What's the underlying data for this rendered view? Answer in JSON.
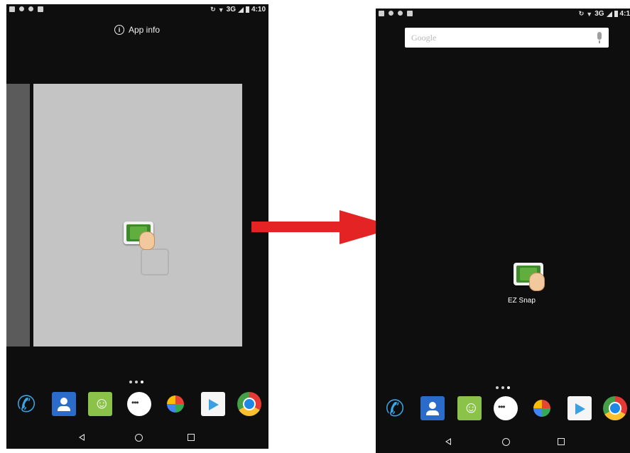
{
  "left_screen": {
    "status_time": "4:10",
    "status_network": "3G",
    "app_info_label": "App info"
  },
  "right_screen": {
    "status_time": "4:1",
    "status_network": "3G",
    "search_placeholder": "Google",
    "app_label": "EZ Snap"
  },
  "dock_apps": [
    "phone-icon",
    "contacts-icon",
    "messaging-icon",
    "app-drawer-icon",
    "photos-icon",
    "play-store-icon",
    "chrome-icon"
  ],
  "nav_buttons": [
    "back",
    "home",
    "recents"
  ],
  "colors": {
    "arrow": "#e42424",
    "screen_bg": "#0e0e0e",
    "drag_page": "#c4c4c4"
  }
}
